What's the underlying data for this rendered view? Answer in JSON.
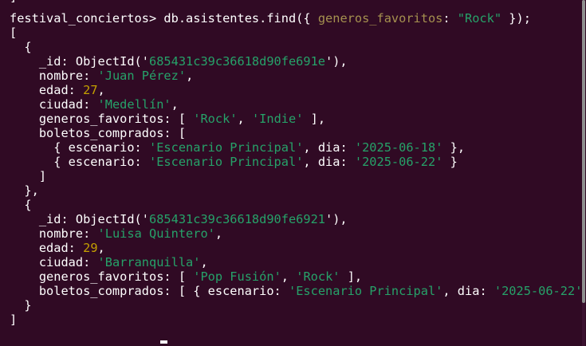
{
  "terminal": {
    "prev_line": "]",
    "prompt": "festival_conciertos>",
    "command_pre": " db.asistentes.find({ ",
    "query_key": "generos_favoritos",
    "query_colon": ": ",
    "query_value": "\"Rock\"",
    "command_post": " });"
  },
  "results": [
    {
      "id": "685431c39c36618d90fe691e",
      "nombre": "Juan Pérez",
      "edad": "27",
      "ciudad": "Medellín",
      "generos_favoritos": [
        "Rock",
        "Indie"
      ],
      "boletos_comprados": [
        {
          "escenario": "Escenario Principal",
          "dia": "2025-06-18"
        },
        {
          "escenario": "Escenario Principal",
          "dia": "2025-06-22"
        }
      ]
    },
    {
      "id": "685431c39c36618d90fe6921",
      "nombre": "Luisa Quintero",
      "edad": "29",
      "ciudad": "Barranquilla",
      "generos_favoritos": [
        "Pop Fusión",
        "Rock"
      ],
      "boletos_comprados": [
        {
          "escenario": "Escenario Principal",
          "dia": "2025-06-22"
        }
      ]
    }
  ],
  "colors": {
    "background": "#300a24",
    "text": "#ffffff",
    "string": "#26a269",
    "number": "#c4a000",
    "query_key": "#a5914f"
  }
}
